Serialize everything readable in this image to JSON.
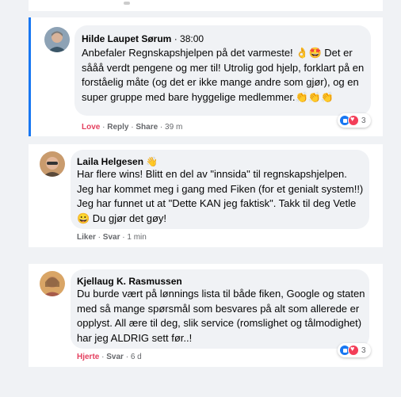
{
  "comments": [
    {
      "author": "Hilde Laupet Sørum",
      "time": "· 38:00",
      "text": "Anbefaler Regnskapshjelpen på det varmeste! 👌🤩 Det er sååå verdt pengene og mer til! Utrolig god hjelp, forklart på en forståelig måte (og det er ikke mange andre som gjør), og en super gruppe med bare hyggelige medlemmer.👏👏👏",
      "reaction_label": "Love",
      "reply_label": "Reply",
      "share_label": "Share",
      "age": "39 m",
      "reaction_count": "3"
    },
    {
      "author": "Laila Helgesen",
      "author_badge": "👋",
      "text": "Har flere wins! Blitt en del av \"innsida\" til regnskapshjelpen. Jeg har kommet meg i gang med Fiken (for et genialt system!!) Jeg har funnet ut at \"Dette KAN jeg faktisk\". Takk til deg Vetle 😀 Du gjør det gøy!",
      "reaction_label": "Liker",
      "reply_label": "Svar",
      "age": "1 min"
    },
    {
      "author": "Kjellaug K. Rasmussen",
      "text": "Du burde vært på lønnings lista til både fiken, Google og staten med så mange spørsmål som besvares på alt som allerede er opplyst. All ære til deg, slik service (romslighet og tålmodighet) har jeg ALDRIG sett før..!",
      "reaction_label": "Hjerte",
      "reply_label": "Svar",
      "age": "6 d",
      "reaction_count": "3"
    }
  ]
}
